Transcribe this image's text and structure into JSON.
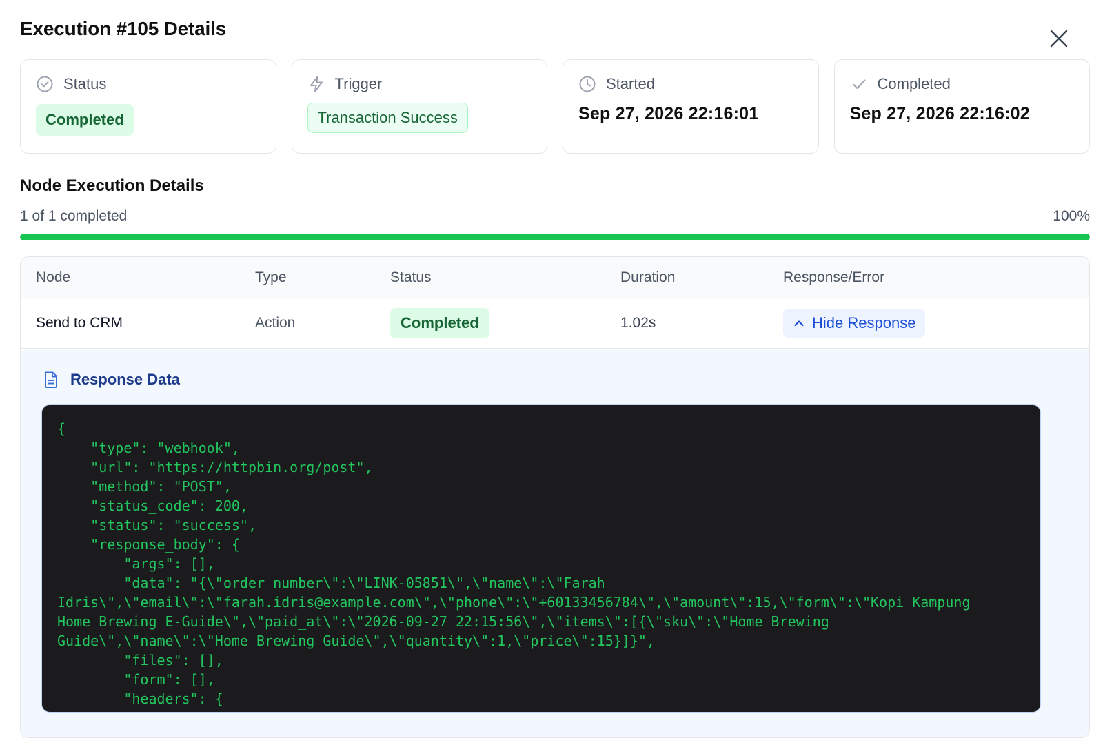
{
  "modal": {
    "title": "Execution #105 Details"
  },
  "summary_cards": [
    {
      "label": "Status",
      "icon": "check-circle-icon",
      "value": "Completed"
    },
    {
      "label": "Trigger",
      "icon": "lightning-icon",
      "value": "Transaction Success"
    },
    {
      "label": "Started",
      "icon": "clock-icon",
      "value": "Sep 27, 2026 22:16:01"
    },
    {
      "label": "Completed",
      "icon": "check-icon",
      "value": "Sep 27, 2026 22:16:02"
    }
  ],
  "node_section": {
    "title": "Node Execution Details",
    "progress_text": "1 of 1 completed",
    "progress_percent_label": "100%",
    "progress_fraction": 1.0,
    "columns": [
      "Node",
      "Type",
      "Status",
      "Duration",
      "Response/Error"
    ],
    "rows": [
      {
        "node": "Send to CRM",
        "type": "Action",
        "status": "Completed",
        "duration": "1.02s",
        "response_action": "Hide Response"
      }
    ]
  },
  "response": {
    "title": "Response Data",
    "code": "{\n    \"type\": \"webhook\",\n    \"url\": \"https://httpbin.org/post\",\n    \"method\": \"POST\",\n    \"status_code\": 200,\n    \"status\": \"success\",\n    \"response_body\": {\n        \"args\": [],\n        \"data\": \"{\\\"order_number\\\":\\\"LINK-05851\\\",\\\"name\\\":\\\"Farah\nIdris\\\",\\\"email\\\":\\\"farah.idris@example.com\\\",\\\"phone\\\":\\\"+60133456784\\\",\\\"amount\\\":15,\\\"form\\\":\\\"Kopi Kampung\nHome Brewing E-Guide\\\",\\\"paid_at\\\":\\\"2026-09-27 22:15:56\\\",\\\"items\\\":[{\\\"sku\\\":\\\"Home Brewing\nGuide\\\",\\\"name\\\":\\\"Home Brewing Guide\\\",\\\"quantity\\\":1,\\\"price\\\":15}]}\",\n        \"files\": [],\n        \"form\": [],\n        \"headers\": {"
  },
  "colors": {
    "success_green": "#16c552",
    "code_text": "#22c55e",
    "code_bg": "#1b1b1d",
    "link_blue": "#1d4ed8"
  }
}
